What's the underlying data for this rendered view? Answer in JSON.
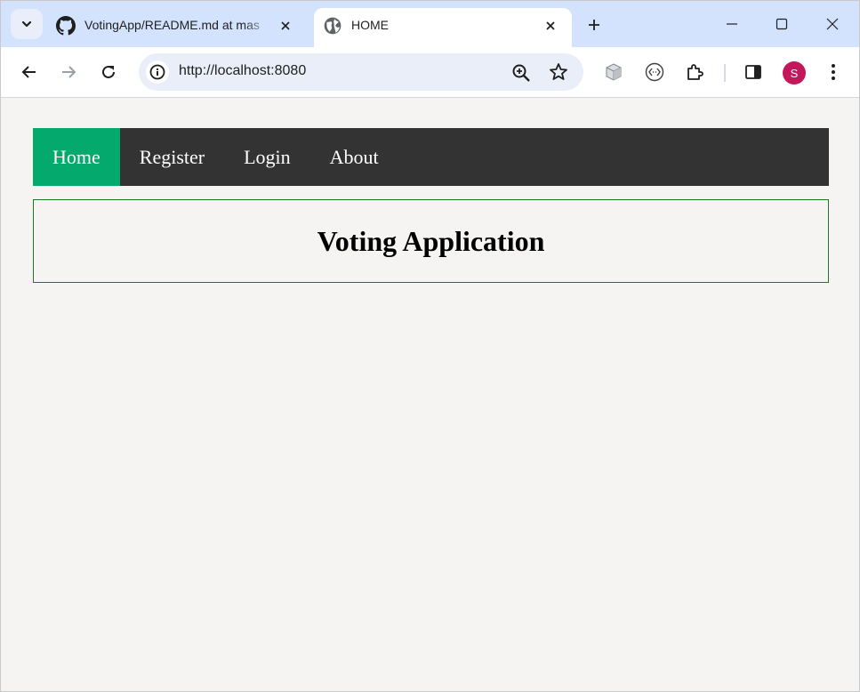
{
  "browser": {
    "tabs": [
      {
        "title": "VotingApp/README.md at mas",
        "icon": "github-icon",
        "active": false
      },
      {
        "title": "HOME",
        "icon": "globe-icon",
        "active": true
      }
    ],
    "url": "http://localhost:8080",
    "profile_initial": "S",
    "colors": {
      "tabstrip": "#d3e3fd",
      "avatar": "#c2185b"
    }
  },
  "page": {
    "nav": {
      "items": [
        {
          "label": "Home",
          "active": true
        },
        {
          "label": "Register",
          "active": false
        },
        {
          "label": "Login",
          "active": false
        },
        {
          "label": "About",
          "active": false
        }
      ]
    },
    "heading": "Voting Application",
    "colors": {
      "nav_bg": "#333333",
      "nav_active": "#04aa6d",
      "header_border": "#1b7a1b",
      "page_bg": "#f5f4f2"
    }
  }
}
